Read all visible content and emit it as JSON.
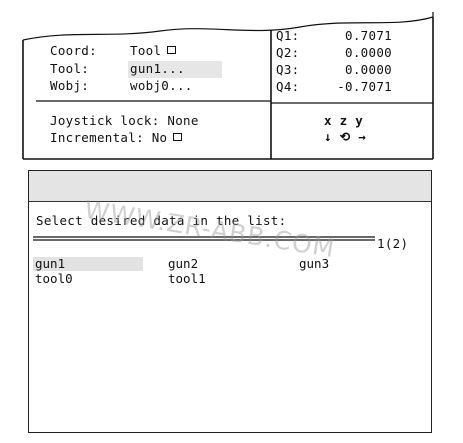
{
  "jog": {
    "coord_label": "Coord:",
    "coord_value": "Tool",
    "tool_label": "Tool:",
    "tool_value": "gun1...",
    "wobj_label": "Wobj:",
    "wobj_value": "wobj0...",
    "joystick_lock": "Joystick lock: None",
    "incremental": "Incremental: No",
    "quaternion": [
      {
        "label": "Q1:",
        "value": "0.7071"
      },
      {
        "label": "Q2:",
        "value": "0.0000"
      },
      {
        "label": "Q3:",
        "value": "0.0000"
      },
      {
        "label": "Q4:",
        "value": "-0.7071"
      }
    ],
    "axes_label": "x z y",
    "axis_arrows": "↓ ⟲ →"
  },
  "list": {
    "prompt": "Select desired data in the list:",
    "counter": "1(2)",
    "items": [
      "gun1",
      "gun2",
      "gun3",
      "tool0",
      "tool1"
    ],
    "selected_item": "gun1"
  },
  "watermark": "WWW.ZR-ABB.COM"
}
